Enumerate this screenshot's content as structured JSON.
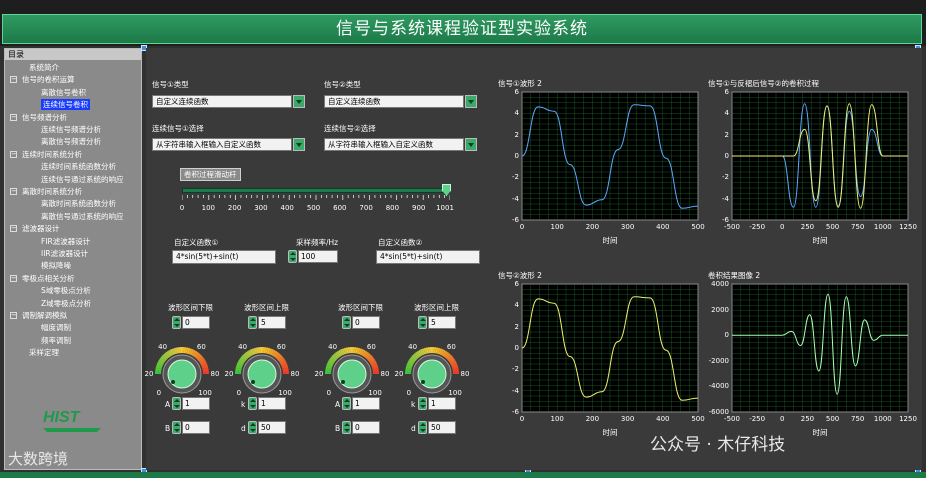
{
  "window": {
    "title": "信号与系统课程验证型实验系统"
  },
  "sidebar": {
    "header": "目录",
    "items": [
      {
        "label": "系统简介",
        "level": 1
      },
      {
        "label": "信号的卷积运算",
        "level": 0,
        "toggle": "−"
      },
      {
        "label": "离散信号卷积",
        "level": 2
      },
      {
        "label": "连续信号卷积",
        "level": 2,
        "selected": true
      },
      {
        "label": "信号频谱分析",
        "level": 0,
        "toggle": "−"
      },
      {
        "label": "连续信号频谱分析",
        "level": 2
      },
      {
        "label": "离散信号频谱分析",
        "level": 2
      },
      {
        "label": "连续时间系统分析",
        "level": 0,
        "toggle": "−"
      },
      {
        "label": "连续时间系统函数分析",
        "level": 2
      },
      {
        "label": "连续信号通过系统的响应",
        "level": 2
      },
      {
        "label": "离散时间系统分析",
        "level": 0,
        "toggle": "−"
      },
      {
        "label": "离散时间系统函数分析",
        "level": 2
      },
      {
        "label": "离散信号通过系统的响应",
        "level": 2
      },
      {
        "label": "滤波器设计",
        "level": 0,
        "toggle": "−"
      },
      {
        "label": "FIR滤波器设计",
        "level": 2
      },
      {
        "label": "IIR滤波器设计",
        "level": 2
      },
      {
        "label": "模拟降噪",
        "level": 2
      },
      {
        "label": "零极点相关分析",
        "level": 0,
        "toggle": "−"
      },
      {
        "label": "S域零极点分析",
        "level": 2
      },
      {
        "label": "Z域零极点分析",
        "level": 2
      },
      {
        "label": "调制解调模拟",
        "level": 0,
        "toggle": "−"
      },
      {
        "label": "幅度调制",
        "level": 2
      },
      {
        "label": "频率调制",
        "level": 2
      },
      {
        "label": "采样定理",
        "level": 1
      }
    ]
  },
  "controls": {
    "sig1_type_label": "信号①类型",
    "sig1_type_value": "自定义连续函数",
    "sig2_type_label": "信号②类型",
    "sig2_type_value": "自定义连续函数",
    "sig1_select_label": "连续信号①选择",
    "sig1_select_value": "从字符串输入框输入自定义函数",
    "sig2_select_label": "连续信号②选择",
    "sig2_select_value": "从字符串输入框输入自定义函数",
    "slider_button": "卷积过程滑动杆",
    "slider_value": 1001,
    "slider_ticks": [
      "0",
      "100",
      "200",
      "300",
      "400",
      "500",
      "600",
      "700",
      "800",
      "900",
      "1001"
    ],
    "func1_label": "自定义函数①",
    "func1_value": "4*sin(5*t)+sin(t)",
    "rate_label": "采样频率/Hz",
    "rate_value": "100",
    "func2_label": "自定义函数②",
    "func2_value": "4*sin(5*t)+sin(t)"
  },
  "waveform_groups": [
    {
      "lower_label": "波形区间下限",
      "lower_value": "0",
      "upper_label": "波形区间上限",
      "upper_value": "5",
      "knob1": {
        "ticks": [
          "0",
          "20",
          "40",
          "60",
          "80",
          "100"
        ]
      },
      "knob2": {
        "ticks": [
          "0",
          "20",
          "40",
          "60",
          "80",
          "100"
        ]
      },
      "A": "1",
      "B": "0",
      "k": "1",
      "d": "50"
    },
    {
      "lower_label": "波形区间下限",
      "lower_value": "0",
      "upper_label": "波形区间上限",
      "upper_value": "5",
      "knob1": {
        "ticks": [
          "0",
          "20",
          "40",
          "60",
          "80",
          "100"
        ]
      },
      "knob2": {
        "ticks": [
          "0",
          "20",
          "40",
          "60",
          "80",
          "100"
        ]
      },
      "A": "1",
      "B": "0",
      "k": "1",
      "d": "50"
    }
  ],
  "param_labels": {
    "A": "A",
    "B": "B",
    "k": "k",
    "d": "d"
  },
  "graphs": [
    {
      "title": "信号①波形 2",
      "xlabel": "时间"
    },
    {
      "title": "信号①与反褶后信号②的卷积过程",
      "xlabel": "时间"
    },
    {
      "title": "信号②波形 2",
      "xlabel": "时间"
    },
    {
      "title": "卷积结果图像 2",
      "xlabel": "时间"
    }
  ],
  "chart_data": [
    {
      "type": "line",
      "title": "信号①波形 2",
      "xlabel": "时间",
      "ylabel": "",
      "xlim": [
        0,
        500
      ],
      "ylim": [
        -6,
        6
      ],
      "xticks": [
        0,
        100,
        200,
        300,
        400,
        500
      ],
      "yticks": [
        -6,
        -4,
        -2,
        0,
        2,
        4,
        6
      ],
      "grid": true,
      "color": "#5fa8ff",
      "series": [
        {
          "values": [
            0,
            4.6,
            4.2,
            -0.8,
            -4.6,
            -4.1,
            0.6,
            4.8,
            4.7,
            -0.2,
            -4.9,
            -4.7
          ]
        }
      ]
    },
    {
      "type": "line",
      "title": "信号①与反褶后信号②的卷积过程",
      "xlabel": "时间",
      "ylabel": "",
      "xlim": [
        -500,
        1250
      ],
      "ylim": [
        -6,
        6
      ],
      "xticks": [
        -500,
        -250,
        0,
        250,
        500,
        750,
        1000,
        1250
      ],
      "yticks": [
        -6,
        -4,
        -2,
        0,
        2,
        4,
        6
      ],
      "grid": true,
      "series": [
        {
          "color": "#5fa8ff",
          "values": [
            0,
            -4.8,
            4.9,
            -4.8,
            4.7,
            -4.7,
            4.2,
            -3.8,
            2.5,
            0
          ]
        },
        {
          "color": "#f0f070",
          "values": [
            0,
            0,
            2.5,
            -4.2,
            4.7,
            -4.8,
            4.9,
            -4.9,
            4.8,
            0
          ]
        }
      ]
    },
    {
      "type": "line",
      "title": "信号②波形 2",
      "xlabel": "时间",
      "ylabel": "",
      "xlim": [
        0,
        500
      ],
      "ylim": [
        -6,
        6
      ],
      "xticks": [
        0,
        100,
        200,
        300,
        400,
        500
      ],
      "yticks": [
        -6,
        -4,
        -2,
        0,
        2,
        4,
        6
      ],
      "grid": true,
      "color": "#f0f070",
      "series": [
        {
          "values": [
            0,
            4.6,
            4.2,
            -0.8,
            -4.6,
            -4.1,
            0.6,
            4.8,
            4.7,
            -0.2,
            -4.9,
            -4.7
          ]
        }
      ]
    },
    {
      "type": "line",
      "title": "卷积结果图像 2",
      "xlabel": "时间",
      "ylabel": "",
      "xlim": [
        -500,
        1250
      ],
      "ylim": [
        -6000,
        4000
      ],
      "xticks": [
        -500,
        -250,
        0,
        250,
        500,
        750,
        1000,
        1250
      ],
      "yticks": [
        -6000,
        -4000,
        -2000,
        0,
        2000,
        4000
      ],
      "grid": true,
      "color": "#a8ffb0",
      "series": [
        {
          "values": [
            0,
            300,
            -800,
            1600,
            -2800,
            3200,
            -4600,
            3000,
            -2400,
            1200,
            -400,
            0
          ]
        }
      ]
    }
  ],
  "watermarks": {
    "left": "大数跨境",
    "right": "公众号 · 木仔科技"
  },
  "colors": {
    "accent_green": "#1d7a48",
    "plot_bg": "#000000",
    "grid": "#1f6b2e",
    "selection": "#1a3cff"
  }
}
